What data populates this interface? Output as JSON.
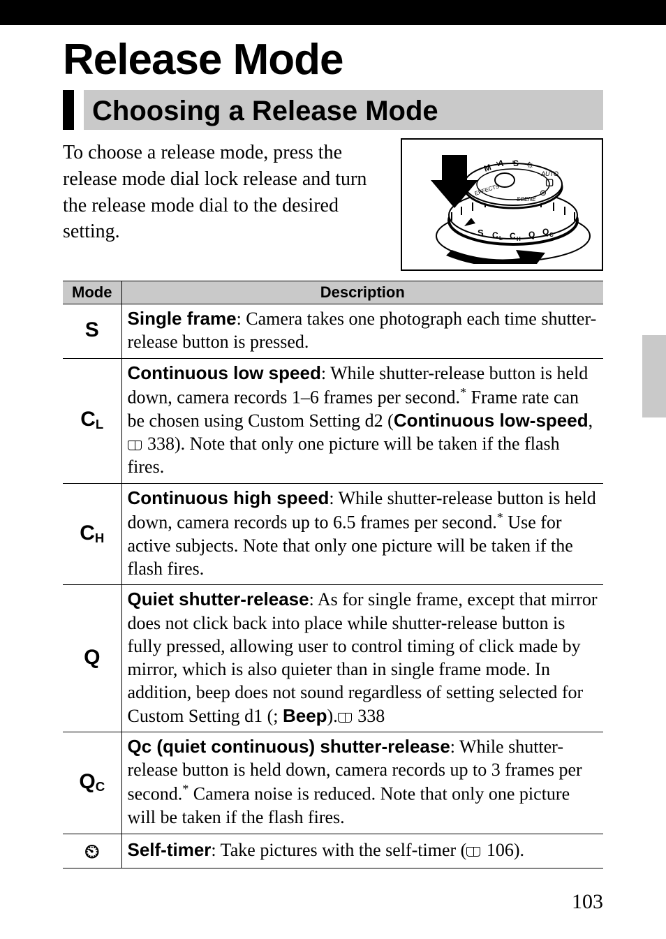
{
  "chapter_title": "Release Mode",
  "section_title": "Choosing a Release Mode",
  "intro": "To choose a release mode, press the release mode dial lock release and turn the release mode dial to the desired setting.",
  "table": {
    "head_mode": "Mode",
    "head_desc": "Description",
    "rows": [
      {
        "mode_html": "S",
        "desc": {
          "lead": "Single frame",
          "rest": ": Camera takes one photograph each time shutter-release button is pressed."
        }
      },
      {
        "mode_html": "C<span class='sub'>L</span>",
        "desc": {
          "lead": "Continuous low speed",
          "pre": ": While shutter-release button is held down, camera records 1–6 frames per second.",
          "ast": "*",
          "post1": " Frame rate can be chosen using Custom Setting d2 (",
          "bold1": "Continuous low-speed",
          "post2": ", ",
          "ref": "338",
          "post3": ").  Note that only one picture will be taken if the flash fires."
        }
      },
      {
        "mode_html": "C<span class='sub'>H</span>",
        "desc": {
          "lead": "Continuous high speed",
          "pre": ": While shutter-release button is held down, camera records up to 6.5 frames per second.",
          "ast": "*",
          "post": " Use for active subjects.  Note that only one picture will be taken if the flash fires."
        }
      },
      {
        "mode_html": "Q",
        "desc": {
          "lead": "Quiet shutter-release",
          "pre": ": As for single frame, except that mirror does not click back into place while shutter-release button is fully pressed, allowing user to control timing of click made by mirror, which is also quieter than in single frame mode.  In addition, beep does not sound regardless of setting selected for Custom Setting d1 (",
          "bold1": "Beep",
          "post1": "; ",
          "ref": "338",
          "post2": ")."
        }
      },
      {
        "mode_html": "Q<span class='sub'>C</span>",
        "desc": {
          "lead": "Qc (quiet continuous) shutter-release",
          "pre": ": While shutter-release button is held down, camera records up to 3 frames per second.",
          "ast": "*",
          "post": " Camera noise is reduced.  Note that only one picture will be taken if the flash fires."
        }
      },
      {
        "mode_html": "TIMER",
        "desc": {
          "lead": "Self-timer",
          "pre": ": Take pictures with the self-timer (",
          "ref": "106",
          "post": ")."
        }
      }
    ]
  },
  "page_number": "103"
}
